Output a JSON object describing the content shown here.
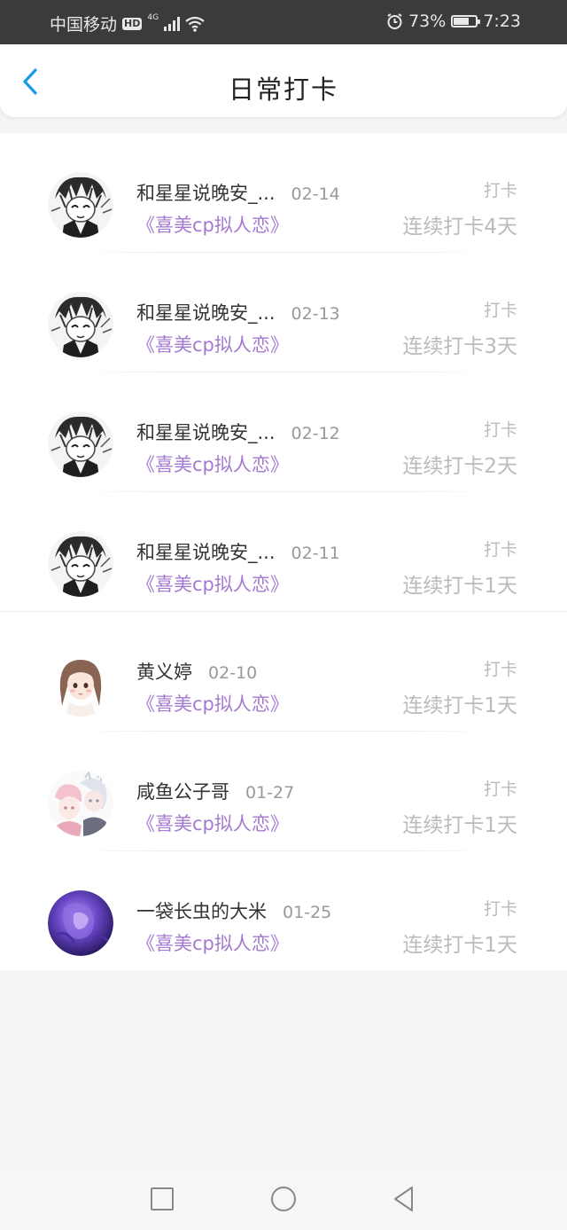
{
  "status_bar": {
    "carrier": "中国移动",
    "hd": "HD",
    "network": "4G",
    "battery_percent": "73%",
    "battery_level": 0.73,
    "time": "7:23",
    "icons": [
      "signal-icon",
      "wifi-icon",
      "alarm-icon",
      "battery-icon"
    ]
  },
  "header": {
    "title": "日常打卡",
    "back_icon": "chevron-left-icon",
    "accent_color": "#1a9be8"
  },
  "checkins": [
    {
      "name": "和星星说晚安_...",
      "date": "02-14",
      "group": "《喜美cp拟人恋》",
      "action": "打卡",
      "streak": "连续打卡4天",
      "avatar": "manga-avatar"
    },
    {
      "name": "和星星说晚安_...",
      "date": "02-13",
      "group": "《喜美cp拟人恋》",
      "action": "打卡",
      "streak": "连续打卡3天",
      "avatar": "manga-avatar"
    },
    {
      "name": "和星星说晚安_...",
      "date": "02-12",
      "group": "《喜美cp拟人恋》",
      "action": "打卡",
      "streak": "连续打卡2天",
      "avatar": "manga-avatar"
    },
    {
      "name": "和星星说晚安_...",
      "date": "02-11",
      "group": "《喜美cp拟人恋》",
      "action": "打卡",
      "streak": "连续打卡1天",
      "avatar": "manga-avatar"
    },
    {
      "name": "黄义婷",
      "date": "02-10",
      "group": "《喜美cp拟人恋》",
      "action": "打卡",
      "streak": "连续打卡1天",
      "avatar": "girl-avatar"
    },
    {
      "name": "咸鱼公子哥",
      "date": "01-27",
      "group": "《喜美cp拟人恋》",
      "action": "打卡",
      "streak": "连续打卡1天",
      "avatar": "anime-pair-avatar"
    },
    {
      "name": "一袋长虫的大米",
      "date": "01-25",
      "group": "《喜美cp拟人恋》",
      "action": "打卡",
      "streak": "连续打卡1天",
      "avatar": "purple-avatar"
    }
  ],
  "colors": {
    "group_text": "#a47ad0",
    "muted_text": "#bbbbbb",
    "page_bg": "#f6f4f5"
  },
  "nav_bar": {
    "icons": [
      "recent-apps-icon",
      "home-icon",
      "back-triangle-icon"
    ]
  }
}
